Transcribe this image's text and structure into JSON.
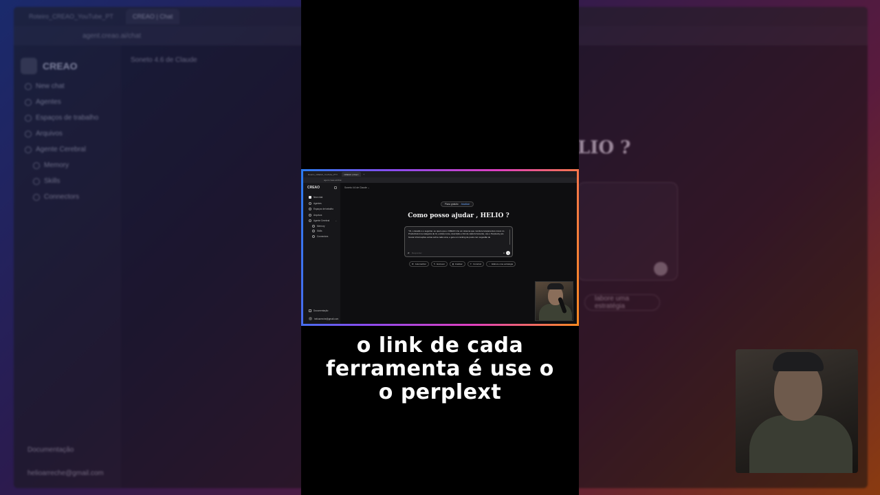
{
  "background_app": {
    "tabs": [
      "Roteiro_CREAO_YouTube_PT",
      "CREAO | Chat"
    ],
    "url": "agent.creao.ai/chat",
    "brand": "CREAO",
    "model": "Soneto 4.6 de Claude",
    "sidebar": [
      "New chat",
      "Agentes",
      "Espaços de trabalho",
      "Arquivos",
      "Agente Cerebral"
    ],
    "sidebar_sub": [
      "Memory",
      "Skills",
      "Connectors"
    ],
    "footer_doc": "Documentação",
    "footer_email": "helioarreche@gmail.com",
    "greeting_partial": "LIO ?",
    "chip_partial": "labore uma estratégia"
  },
  "screenshot": {
    "tabs": [
      "Roteiro_CREAO_YouTube_PT",
      "CREAO | Chat"
    ],
    "url": "agent.creao.ai/chat",
    "brand": "CREAO",
    "model": "Soneto 4.6 de Claude",
    "sidebar": [
      {
        "label": "New chat",
        "icon": "plus-icon"
      },
      {
        "label": "Agentes",
        "icon": "agent-icon"
      },
      {
        "label": "Espaços de trabalho",
        "icon": "folder-icon"
      },
      {
        "label": "Arquivos",
        "icon": "file-icon"
      },
      {
        "label": "Agente Cerebral",
        "icon": "brain-icon"
      }
    ],
    "sidebar_sub": [
      "Memory",
      "Skills",
      "Connectors"
    ],
    "footer_doc": "Documentação",
    "footer_email": "helioarreche@gmail.com",
    "plan_label": "Plano gratuito",
    "plan_action": "Atualizar",
    "greeting": "Como posso ajudar , HELIO ?",
    "prompt_text": "\"Oi, o desafio é o seguinte: eu quero que o CREAO crie um sistema que monitore lançamentos novos no ProductHunt na categoria de IA, extraia nome, descrição e link de cada ferramenta, use o Perplexity pra buscar informações extras sobre cada uma, e gere um ranking de posts com sugestão de",
    "input_placeholder": "Responder",
    "chips": [
      "Automatizar",
      "Escrever",
      "Analisar",
      "Construir",
      "Elabore uma estratégia"
    ]
  },
  "caption": [
    "o link de cada",
    "ferramenta é use o",
    "o perplext"
  ]
}
